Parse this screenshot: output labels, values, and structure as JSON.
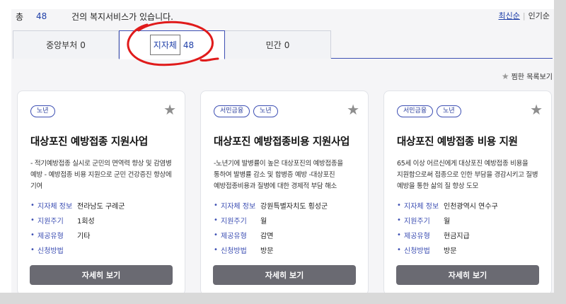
{
  "header": {
    "total_label": "총",
    "total_count": "48",
    "count_suffix": "건의 복지서비스가 있습니다.",
    "sort_newest": "최신순",
    "sort_separator": "|",
    "sort_popular": "인기순"
  },
  "tabs": [
    {
      "label": "중앙부처",
      "count": "0",
      "active": false
    },
    {
      "label": "지자체",
      "count": "48",
      "active": true
    },
    {
      "label": "민간",
      "count": "0",
      "active": false
    }
  ],
  "favorites_link": "찜한 목록보기",
  "detail_button_label": "자세히 보기",
  "cards": [
    {
      "tags": [
        "노년"
      ],
      "title": "대상포진 예방접종 지원사업",
      "description": "- 적기예방접종 실시로 군민의 면역력 향상 및 감염병 예방 - 예방접종 비용 지원으로 군민 건강증진 향상에 기여",
      "info": [
        {
          "key": "지자체 정보",
          "value": "전라남도 구례군"
        },
        {
          "key": "지원주기",
          "value": "1회성"
        },
        {
          "key": "제공유형",
          "value": "기타"
        },
        {
          "key": "신청방법",
          "value": ""
        }
      ]
    },
    {
      "tags": [
        "서민금융",
        "노년"
      ],
      "title": "대상포진 예방접종비용 지원사업",
      "description": "-노년기에 발병률이 높은 대상포진의 예방접종을 통하여 발병률 감소 및 합병증 예방 -대상포진 예방접종비용과 질병에 대한 경제적 부담 해소",
      "info": [
        {
          "key": "지자체 정보",
          "value": "강원특별자치도 횡성군"
        },
        {
          "key": "지원주기",
          "value": "월"
        },
        {
          "key": "제공유형",
          "value": "감면"
        },
        {
          "key": "신청방법",
          "value": "방문"
        }
      ]
    },
    {
      "tags": [
        "서민금융",
        "노년"
      ],
      "title": "대상포진 예방접종 비용 지원",
      "description": "65세 이상 어르신에게 대상포진 예방접종 비용을 지원함으로써 접종으로 인한 부담을 경감시키고 질병 예방을 통한 삶의 질 향상 도모",
      "info": [
        {
          "key": "지자체 정보",
          "value": "인천광역시 연수구"
        },
        {
          "key": "지원주기",
          "value": "월"
        },
        {
          "key": "제공유형",
          "value": "현금지급"
        },
        {
          "key": "신청방법",
          "value": "방문"
        }
      ]
    }
  ],
  "colors": {
    "accent": "#1f3fa8",
    "tab_border": "#3d4fb3",
    "button_bg": "#6a6a72",
    "annotation": "#e01b1b"
  },
  "icons": {
    "favorite": "star-icon",
    "bullet": "dot-bullet"
  }
}
